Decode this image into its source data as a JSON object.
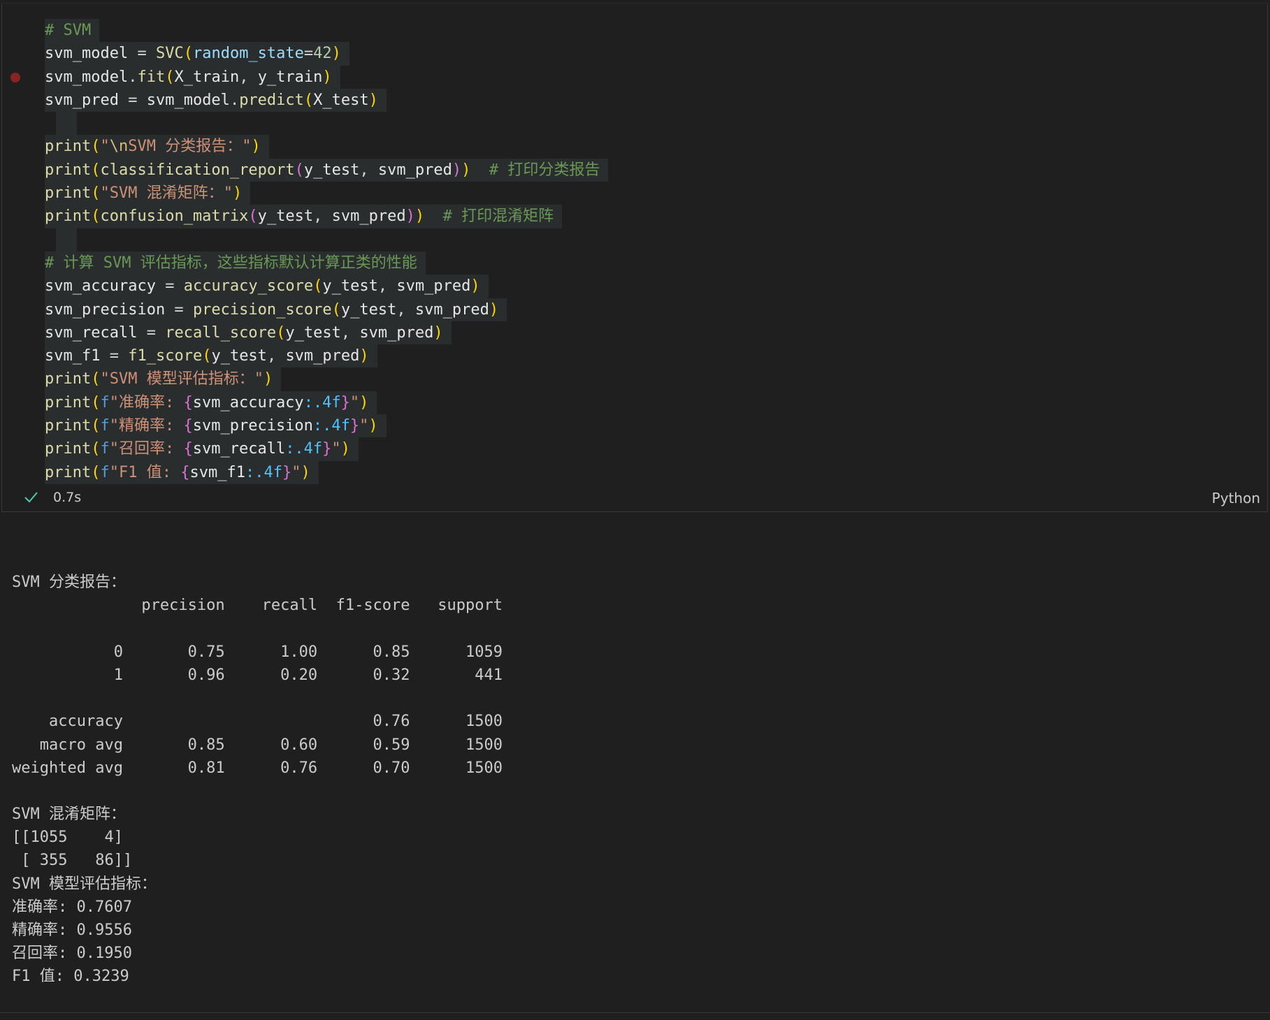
{
  "cell": {
    "exec_time": "0.7s",
    "language": "Python",
    "status_icon": "check-icon",
    "breakpoint_color": "#8b2323"
  },
  "code": {
    "l1": "# SVM",
    "l2_var": "svm_model",
    "l2_fn": "SVC",
    "l2_param": "random_state",
    "l2_num": "42",
    "l3_obj": "svm_model",
    "l3_fn": "fit",
    "l3_a1": "X_train",
    "l3_a2": "y_train",
    "l4_var": "svm_pred",
    "l4_obj": "svm_model",
    "l4_fn": "predict",
    "l4_a1": "X_test",
    "l6_fn": "print",
    "l6_esc": "\\n",
    "l6_str": "SVM 分类报告：",
    "l7_fn": "print",
    "l7_fn2": "classification_report",
    "l7_a1": "y_test",
    "l7_a2": "svm_pred",
    "l7_cmt": "# 打印分类报告",
    "l8_fn": "print",
    "l8_str": "SVM 混淆矩阵：",
    "l9_fn": "print",
    "l9_fn2": "confusion_matrix",
    "l9_a1": "y_test",
    "l9_a2": "svm_pred",
    "l9_cmt": "# 打印混淆矩阵",
    "l11_cmt": "# 计算 SVM 评估指标，这些指标默认计算正类的性能",
    "l12_var": "svm_accuracy",
    "l12_fn": "accuracy_score",
    "l13_var": "svm_precision",
    "l13_fn": "precision_score",
    "l14_var": "svm_recall",
    "l14_fn": "recall_score",
    "l15_var": "svm_f1",
    "l15_fn": "f1_score",
    "a_ytest": "y_test",
    "a_svmpred": "svm_pred",
    "l16_str": "SVM 模型评估指标：",
    "l17_label": "准确率: ",
    "l17_var": "svm_accuracy",
    "l18_label": "精确率: ",
    "l18_var": "svm_precision",
    "l19_label": "召回率: ",
    "l19_var": "svm_recall",
    "l20_label": "F1 值: ",
    "l20_var": "svm_f1",
    "fmt": ":.4f",
    "print_fn": "print",
    "f_prefix": "f"
  },
  "output": {
    "lines": [
      "",
      "SVM 分类报告：",
      "              precision    recall  f1-score   support",
      "",
      "           0       0.75      1.00      0.85      1059",
      "           1       0.96      0.20      0.32       441",
      "",
      "    accuracy                           0.76      1500",
      "   macro avg       0.85      0.60      0.59      1500",
      "weighted avg       0.81      0.76      0.70      1500",
      "",
      "SVM 混淆矩阵：",
      "[[1055    4]",
      " [ 355   86]]",
      "SVM 模型评估指标：",
      "准确率: 0.7607",
      "精确率: 0.9556",
      "召回率: 0.1950",
      "F1 值: 0.3239"
    ]
  }
}
